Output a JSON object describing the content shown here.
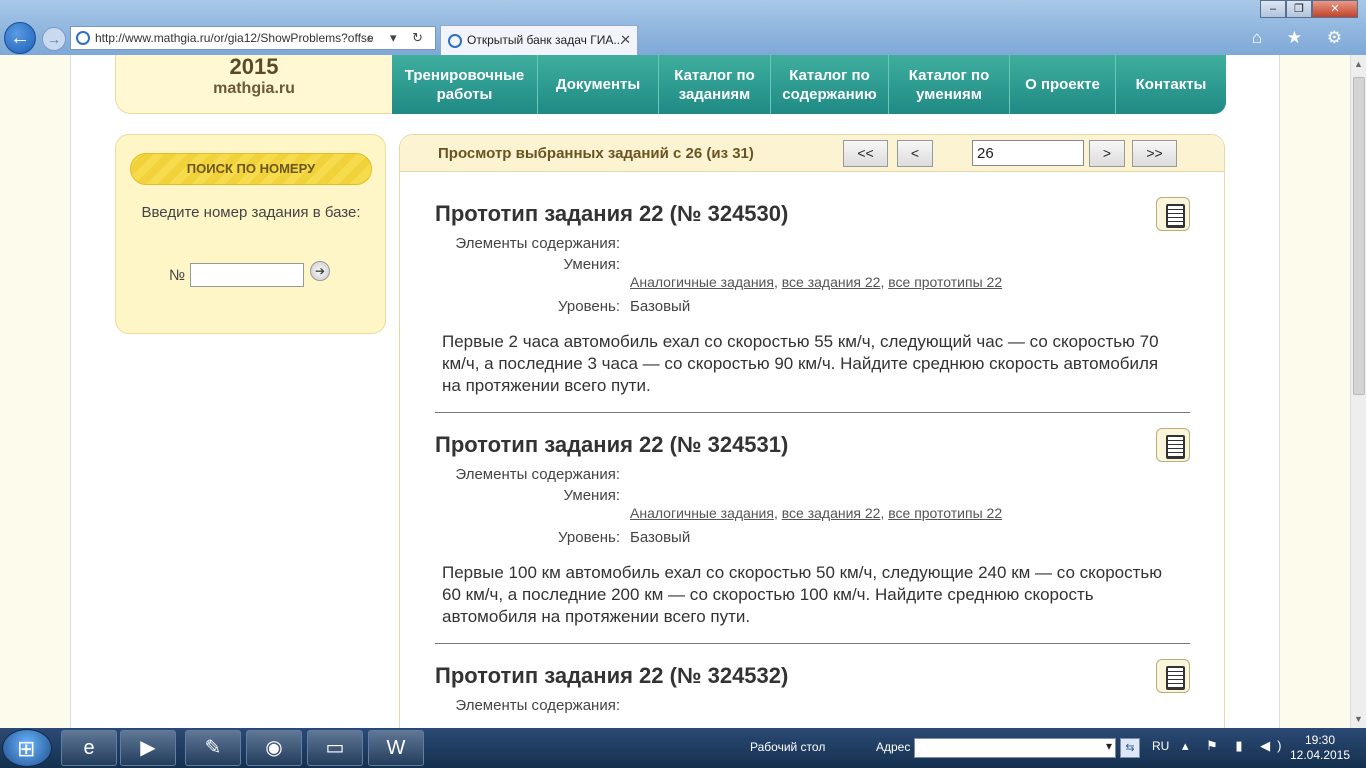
{
  "browser": {
    "url": "http://www.mathgia.ru/or/gia12/ShowProblems?offse",
    "tab_title": "Открытый банк задач ГИА...",
    "tab_close": "✕",
    "win_min": "–",
    "win_max": "❐",
    "win_close": "✕",
    "back": "←",
    "forward": "→",
    "addr_controls": "⌕ ▾ ↻",
    "icons": "⌂ ★ ⚙"
  },
  "site": {
    "logo_year": "2015",
    "logo_site": "mathgia.ru",
    "nav": [
      {
        "label": "Тренировочные работы"
      },
      {
        "label": "Документы"
      },
      {
        "label": "Каталог по заданиям"
      },
      {
        "label": "Каталог по содержанию"
      },
      {
        "label": "Каталог по умениям"
      },
      {
        "label": "О проекте"
      },
      {
        "label": "Контакты"
      }
    ]
  },
  "search": {
    "banner": "ПОИСК ПО НОМЕРУ",
    "label": "Введите номер задания в базе:",
    "num_prefix": "№",
    "input_value": "",
    "go_icon": "➔"
  },
  "pager": {
    "title": "Просмотр выбранных заданий с 26 (из 31)",
    "first": "<<",
    "prev": "<",
    "page_value": "26",
    "next": ">",
    "last": ">>"
  },
  "meta_labels": {
    "content": "Элементы содержания:",
    "skills": "Умения:",
    "level": "Уровень:"
  },
  "links": {
    "similar": "Аналогичные задания",
    "all_tasks": "все задания 22",
    "all_prototypes": "все прототипы 22",
    "sep": ", "
  },
  "problems": [
    {
      "title": "Прототип задания 22 (№ 324530)",
      "level": "Базовый",
      "text": "Первые 2 часа автомобиль ехал со скоростью 55 км/ч, следующий час — со скоростью 70 км/ч, а последние 3 часа — со скоростью 90 км/ч. Найдите среднюю скорость автомобиля на протяжении всего пути."
    },
    {
      "title": "Прототип задания 22 (№ 324531)",
      "level": "Базовый",
      "text": "Первые 100 км автомобиль ехал со скоростью 50 км/ч, следующие 240 км — со скоростью 60 км/ч, а последние 200 км — со скоростью 100 км/ч. Найдите среднюю скорость автомобиля на протяжении всего пути."
    },
    {
      "title": "Прототип задания 22 (№ 324532)",
      "level": "",
      "text": ""
    }
  ],
  "taskbar": {
    "desktop_label": "Рабочий стол",
    "address_label": "Адрес",
    "lang": "RU",
    "tray": "▴ ⚑ ▮ ◀)",
    "time": "19:30",
    "date": "12.04.2015",
    "apps": [
      {
        "icon": "e"
      },
      {
        "icon": "▶"
      },
      {
        "icon": "✎"
      },
      {
        "icon": "◉"
      },
      {
        "icon": "▭"
      },
      {
        "icon": "W"
      }
    ]
  }
}
